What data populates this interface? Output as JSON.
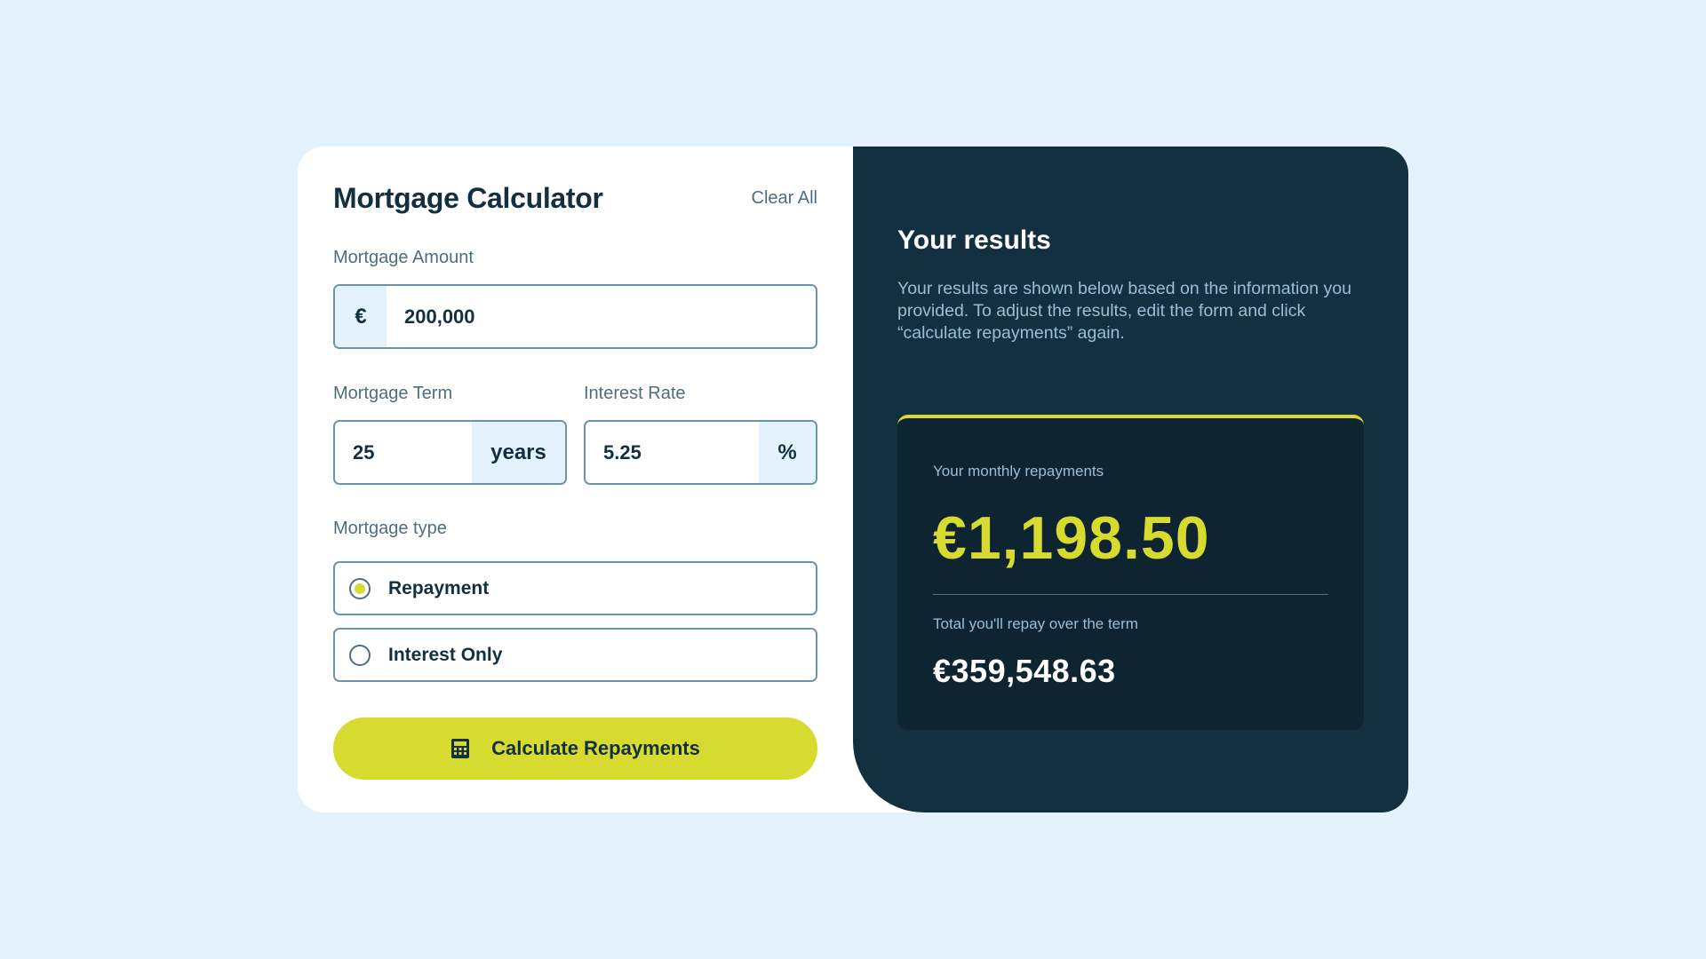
{
  "colors": {
    "background": "#E3F2FC",
    "accent": "#D7DA2F",
    "dark_panel": "#133040",
    "summary_box": "#0E2431",
    "text_dark": "#133040",
    "text_muted": "#4E6E7E",
    "border": "#6B94A8"
  },
  "form": {
    "title": "Mortgage Calculator",
    "clear_all_label": "Clear All",
    "amount": {
      "label": "Mortgage Amount",
      "prefix": "€",
      "value": "200,000"
    },
    "term": {
      "label": "Mortgage Term",
      "value": "25",
      "suffix": "years"
    },
    "rate": {
      "label": "Interest Rate",
      "value": "5.25",
      "suffix": "%"
    },
    "mortgage_type": {
      "label": "Mortgage type",
      "options": [
        {
          "label": "Repayment",
          "selected": true
        },
        {
          "label": "Interest Only",
          "selected": false
        }
      ]
    },
    "submit": {
      "label": "Calculate Repayments",
      "icon": "calculator-icon"
    }
  },
  "results": {
    "title": "Your results",
    "description": "Your results are shown below based on the information you provided. To adjust the results, edit the form and click “calculate repayments” again.",
    "monthly_label": "Your monthly repayments",
    "monthly_value": "€1,198.50",
    "total_label": "Total you'll repay over the term",
    "total_value": "€359,548.63"
  }
}
